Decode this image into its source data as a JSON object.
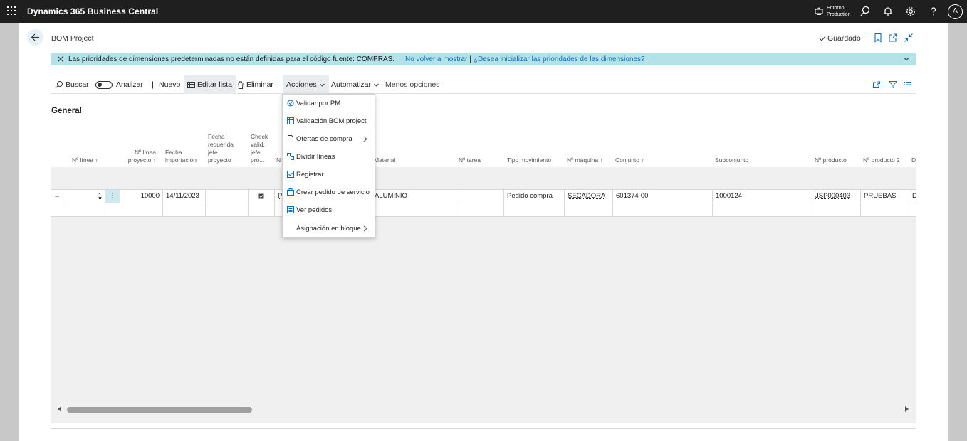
{
  "app": {
    "title": "Dynamics 365 Business Central",
    "environment": "Entorno:\nProduction",
    "user_initial": "A"
  },
  "page": {
    "title": "BOM Project",
    "status": "Guardado"
  },
  "notification": {
    "message": "Las prioridades de dimensiones predeterminadas no están definidas para el código fuente: COMPRAS.",
    "action1": "No volver a mostrar",
    "separator": "|",
    "action2": "¿Desea inicializar las prioridades de las dimensiones?"
  },
  "actions": {
    "search": "Buscar",
    "analyze": "Analizar",
    "new": "Nuevo",
    "edit_list": "Editar lista",
    "delete": "Eliminar",
    "actions": "Acciones",
    "automate": "Automatizar",
    "fewer_options": "Menos opciones"
  },
  "section": {
    "title": "General"
  },
  "columns": {
    "line_no": "Nº línea",
    "project_line_no": "Nº línea proyecto",
    "import_date": "Fecha importación",
    "required_date": "Fecha requerida jefe proyecto",
    "check_valid": "Check valid. jefe pro...",
    "partial": "N",
    "material": "Material",
    "task_no": "Nº tarea",
    "movement_type": "Tipo movimiento",
    "machine_no": "Nº máquina",
    "assembly": "Conjunto",
    "subassembly": "Subconjunto",
    "product_no": "Nº producto",
    "product_no_2": "Nº producto 2",
    "desc": "D"
  },
  "row": {
    "line_no": "1",
    "dots": "⋮",
    "project_line_no": "10000",
    "import_date": "14/11/2023",
    "partial": "P",
    "material": "ALUMINIO",
    "movement_type": "Pedido compra",
    "machine_no": "SECADORA",
    "assembly": "601374-00",
    "subassembly": "1000124",
    "product_no": "JSP000403",
    "product_no_2": "PRUEBAS",
    "desc": "D"
  },
  "menu": {
    "items": [
      {
        "label": "Validar por PM",
        "icon": "validate-icon"
      },
      {
        "label": "Validación BOM project",
        "icon": "bom-icon"
      },
      {
        "label": "Ofertas de compra",
        "icon": "document-icon"
      },
      {
        "label": "Dividir líneas",
        "icon": "split-icon"
      },
      {
        "label": "Registrar",
        "icon": "post-icon"
      },
      {
        "label": "Crear pedido de servicio",
        "icon": "service-icon"
      },
      {
        "label": "Ver pedidos",
        "icon": "orders-icon"
      },
      {
        "label": "Asignación en bloque",
        "icon": ""
      }
    ]
  },
  "colors": {
    "topbar": "#1f1f1f",
    "notice": "#b3e3e8",
    "accent": "#0f6cbd"
  }
}
